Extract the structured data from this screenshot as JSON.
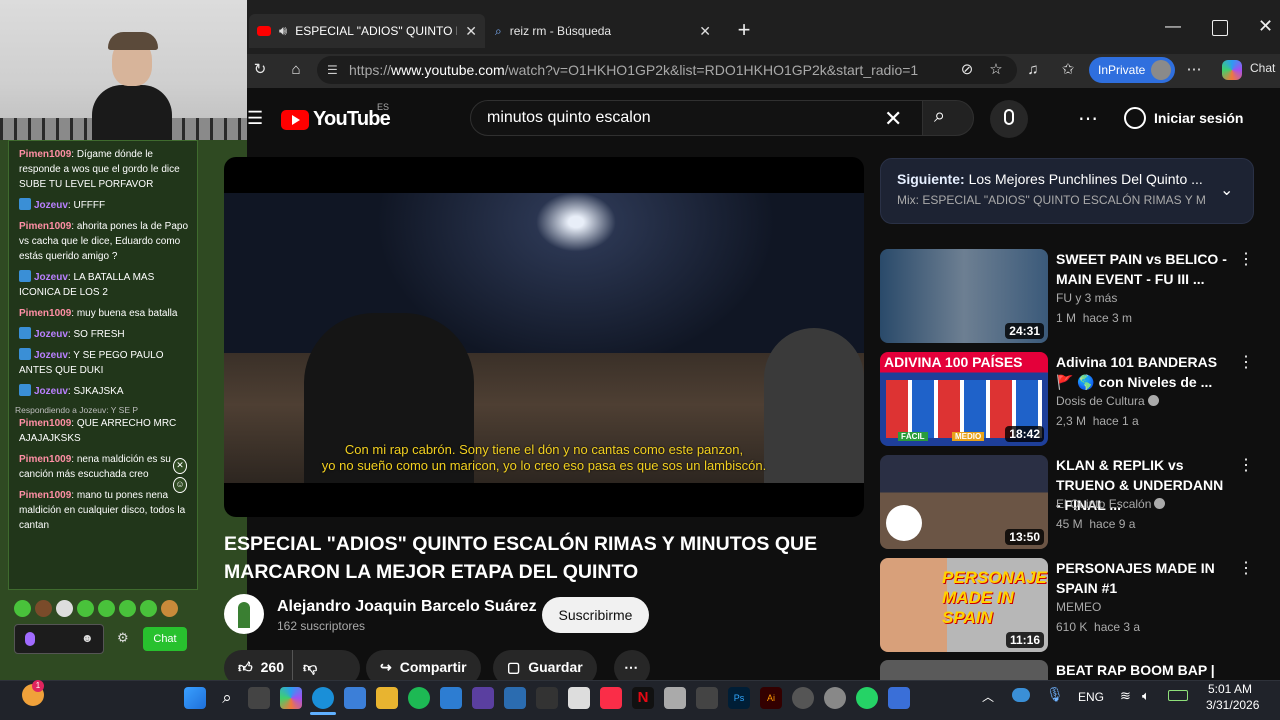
{
  "browser": {
    "tabs": [
      {
        "title": "ESPECIAL \"ADIOS\" QUINTO ES",
        "active": true
      },
      {
        "title": "reiz rm - Búsqueda",
        "active": false
      }
    ],
    "url_prefix": "https://",
    "url_host": "www.youtube.com",
    "url_path": "/watch?v=O1HKHO1GP2k&list=RDO1HKHO1GP2k&start_radio=1",
    "inprivate_label": "InPrivate",
    "copilot_label": "Chat"
  },
  "youtube": {
    "logo_text": "YouTube",
    "country": "ES",
    "search_value": "minutos quinto escalon",
    "signin_label": "Iniciar sesión",
    "video": {
      "subtitle": "Con mi rap cabrón. Sony tiene el dón y no cantas como este panzon,\nyo no sueño como un maricon, yo lo creo eso pasa es que sos un lambiscón.",
      "title": "ESPECIAL \"ADIOS\" QUINTO ESCALÓN RIMAS Y MINUTOS QUE MARCARON LA MEJOR ETAPA DEL QUINTO",
      "channel": "Alejandro Joaquin Barcelo Suárez",
      "subscribers": "162 suscriptores",
      "subscribe_label": "Suscribirme",
      "likes": "260",
      "share_label": "Compartir",
      "save_label": "Guardar"
    },
    "up_next": {
      "label": "Siguiente:",
      "title": "Los Mejores Punchlines Del Quinto ...",
      "mix": "Mix: ESPECIAL \"ADIOS\" QUINTO ESCALÓN RIMAS Y MINU"
    },
    "recommendations": [
      {
        "title": "SWEET PAIN vs BELICO - MAIN EVENT - FU III ...",
        "channel": "FU y 3 más",
        "views": "1 M",
        "age": "hace 3 m",
        "duration": "24:31",
        "verified": false
      },
      {
        "title": "Adivina 101 BANDERAS 🚩 🌎 con Niveles de ...",
        "channel": "Dosis de Cultura",
        "views": "2,3 M",
        "age": "hace 1 a",
        "duration": "18:42",
        "verified": true
      },
      {
        "title": "KLAN & REPLIK vs TRUENO & UNDERDANN - FINAL ...",
        "channel": "El Quinto Escalón",
        "views": "45 M",
        "age": "hace 9 a",
        "duration": "13:50",
        "verified": true
      },
      {
        "title": "PERSONAJES MADE IN SPAIN #1",
        "channel": "MEMEO",
        "views": "610 K",
        "age": "hace 3 a",
        "duration": "11:16",
        "verified": false
      },
      {
        "title": "BEAT RAP BOOM BAP |",
        "channel": "",
        "views": "",
        "age": "",
        "duration": "",
        "verified": false
      }
    ],
    "thumb_texts": {
      "adivina": "ADIVINA 100 PAÍSES",
      "facil": "FÁCIL",
      "medio": "MEDIO",
      "personajes": "PERSONAJES MADE IN SPAIN"
    }
  },
  "stream_chat": {
    "messages": [
      {
        "user": "Pimen1009",
        "text": "Dígame dónde le responde a wos que el gordo le dice SUBE TU LEVEL PORFAVOR",
        "badge": false
      },
      {
        "user": "Jozeuv",
        "text": "UFFFF",
        "badge": true
      },
      {
        "user": "Pimen1009",
        "text": "ahorita pones la de Papo vs cacha que le dice, Eduardo como estás querido amigo ?",
        "badge": false
      },
      {
        "user": "Jozeuv",
        "text": "LA BATALLA MAS ICONICA DE LOS 2",
        "badge": true
      },
      {
        "user": "Pimen1009",
        "text": "muy buena esa batalla",
        "badge": false
      },
      {
        "user": "Jozeuv",
        "text": "SO FRESH",
        "badge": true
      },
      {
        "user": "Jozeuv",
        "text": "Y SE PEGO PAULO ANTES QUE DUKI",
        "badge": true
      },
      {
        "user": "Jozeuv",
        "text": "SJKAJSKA",
        "badge": true
      }
    ],
    "reply_context": "Respondiendo a Jozeuv: Y SE P",
    "messages_after": [
      {
        "user": "Pimen1009",
        "text": "QUE ARRECHO MRC AJAJAJKSKS"
      },
      {
        "user": "Pimen1009",
        "text": "nena maldición es su canción más escuchada creo"
      },
      {
        "user": "Pimen1009",
        "text": "mano tu pones nena maldición en cualquier disco, todos la cantan"
      }
    ],
    "chat_button": "Chat"
  },
  "taskbar": {
    "time": "5:01 AM",
    "date": "3/31/2026",
    "language": "ENG",
    "notification_badge": "1"
  }
}
